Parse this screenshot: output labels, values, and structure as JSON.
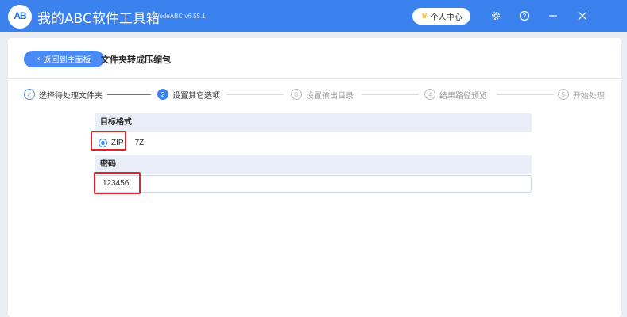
{
  "app": {
    "logo_text": "AB",
    "title": "我的ABC软件工具箱",
    "version": "WodeABC v6.55.1",
    "user_center_label": "个人中心",
    "title_icons": [
      "gear-icon",
      "help-icon",
      "minimize-icon",
      "close-icon"
    ]
  },
  "header": {
    "back_label": "返回到主面板",
    "page_title": "文件夹转成压缩包"
  },
  "steps": [
    {
      "num": "✓",
      "label": "选择待处理文件夹",
      "state": "done"
    },
    {
      "num": "2",
      "label": "设置其它选项",
      "state": "active"
    },
    {
      "num": "3",
      "label": "设置输出目录",
      "state": "pending"
    },
    {
      "num": "4",
      "label": "结果路径预览",
      "state": "pending"
    },
    {
      "num": "5",
      "label": "开始处理",
      "state": "pending"
    }
  ],
  "format": {
    "heading": "目标格式",
    "options": [
      "ZIP",
      "7Z"
    ],
    "selected": "ZIP"
  },
  "password": {
    "heading": "密码",
    "value": "123456"
  },
  "colors": {
    "accent": "#3b82ee",
    "highlight": "#e0242c"
  }
}
